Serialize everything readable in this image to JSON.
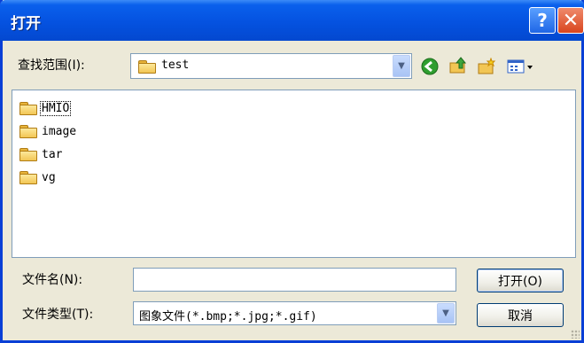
{
  "window": {
    "title": "打开",
    "help_glyph": "?",
    "close_glyph": "✕"
  },
  "look_in": {
    "label": "查找范围(I):",
    "value": "test"
  },
  "toolbar": {
    "icons": [
      "back-icon",
      "up-folder-icon",
      "new-folder-icon",
      "view-menu-icon"
    ]
  },
  "files": [
    {
      "name": "HMIO"
    },
    {
      "name": "image"
    },
    {
      "name": "tar"
    },
    {
      "name": "vg"
    }
  ],
  "filename": {
    "label": "文件名(N):",
    "value": ""
  },
  "filetype": {
    "label": "文件类型(T):",
    "value": "图象文件(*.bmp;*.jpg;*.gif)"
  },
  "buttons": {
    "open": "打开(O)",
    "cancel": "取消"
  },
  "colors": {
    "titlebar": "#0552e0",
    "dialog_bg": "#ece9d8",
    "close_red": "#d9451e"
  }
}
